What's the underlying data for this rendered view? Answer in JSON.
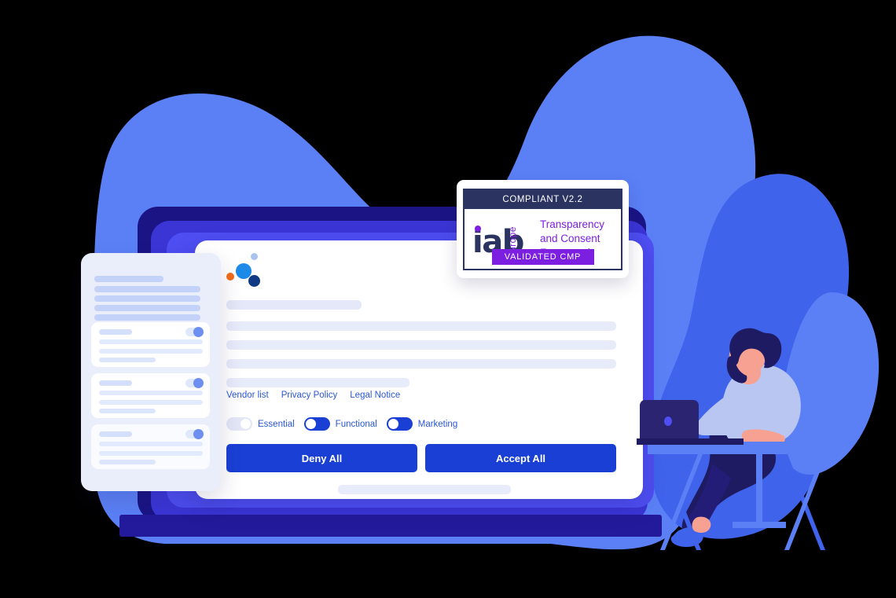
{
  "scene": {
    "title": "IAB Europe TCF v2.2 validated consent management platform illustration",
    "colors": {
      "blob_light": "#5b80f6",
      "blob_deep": "#3f63ea",
      "monitor_outer": "#1a1485",
      "monitor_mid": "#3b35d6",
      "monitor_inner": "#4e4ef2",
      "monitor_base": "#231a9b",
      "button_blue": "#1a3fd4",
      "link_blue": "#2a57d6",
      "skeleton": "#e8ebfa",
      "badge_navy": "#2b3360",
      "badge_purple": "#7c1fe0",
      "skin": "#f7a193",
      "hair_navy": "#1f1b63",
      "shirt": "#b9c6f2",
      "desk_blue": "#5b80f6"
    }
  },
  "banner": {
    "logo_dots": [
      {
        "name": "dot-lightblue",
        "color": "#a9c3ee"
      },
      {
        "name": "dot-blue",
        "color": "#1d8ae8"
      },
      {
        "name": "dot-orange",
        "color": "#f36c18"
      },
      {
        "name": "dot-navy",
        "color": "#113a86"
      }
    ],
    "links": [
      {
        "label": "Vendor list"
      },
      {
        "label": "Privacy Policy"
      },
      {
        "label": "Legal Notice"
      }
    ],
    "toggles": [
      {
        "label": "Essential",
        "state": "off",
        "disabled": true
      },
      {
        "label": "Functional",
        "state": "on",
        "disabled": false
      },
      {
        "label": "Marketing",
        "state": "on",
        "disabled": false
      }
    ],
    "buttons": {
      "deny_label": "Deny All",
      "accept_label": "Accept All"
    }
  },
  "settings_card": {
    "items": [
      {
        "name": "purpose-row-1"
      },
      {
        "name": "purpose-row-2"
      },
      {
        "name": "purpose-row-3"
      }
    ]
  },
  "iab_badge": {
    "top_label": "COMPLIANT V2.2",
    "logo_text": "iab",
    "logo_region": "europe",
    "framework_text": "Transparency\nand Consent\nFramework",
    "bottom_label": "VALIDATED CMP"
  }
}
